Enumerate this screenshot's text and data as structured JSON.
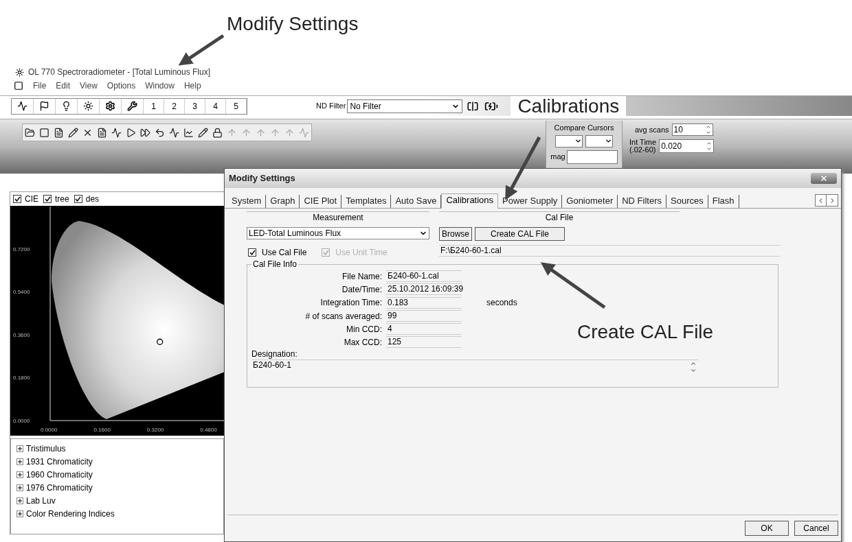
{
  "annotations": [
    {
      "text": "Modify Settings"
    },
    {
      "text": "Calibrations"
    },
    {
      "text": "Create CAL File"
    }
  ],
  "window": {
    "title": "OL 770 Spectroradiometer - [Total Luminous Flux]"
  },
  "menu": [
    "File",
    "Edit",
    "View",
    "Options",
    "Window",
    "Help"
  ],
  "toolbar": {
    "number_buttons": [
      "1",
      "2",
      "3",
      "4",
      "5"
    ],
    "nd_filter": {
      "label": "ND Filter",
      "value": "No Filter"
    }
  },
  "compare_cursors": {
    "label": "Compare Cursors",
    "mag_label": "mag"
  },
  "avg_scans": {
    "label": "avg scans",
    "value": "10"
  },
  "int_time": {
    "label": "Int Time",
    "range": "(.02-60)",
    "value": "0.020"
  },
  "left_panel": {
    "checkboxes": [
      {
        "label": "CIE",
        "checked": true
      },
      {
        "label": "tree",
        "checked": true
      },
      {
        "label": "des",
        "checked": true
      }
    ],
    "chart_data": {
      "type": "scatter",
      "x": [
        0.33
      ],
      "series": [
        {
          "color": "#000000",
          "values": [
            0.33
          ]
        }
      ],
      "xlim": [
        0,
        0.525
      ],
      "ylim": [
        0,
        0.9
      ],
      "xticks": [
        {
          "value": 0,
          "label": "0.0000"
        },
        {
          "value": 0.16,
          "label": "0.1600"
        },
        {
          "value": 0.32,
          "label": "0.3200"
        },
        {
          "value": 0.48,
          "label": "0.4800"
        }
      ],
      "yticks": [
        {
          "value": 0,
          "label": "0.0000"
        },
        {
          "value": 0.18,
          "label": "0.1800"
        },
        {
          "value": 0.36,
          "label": "0.3600"
        },
        {
          "value": 0.54,
          "label": "0.5400"
        },
        {
          "value": 0.72,
          "label": "0.7200"
        }
      ]
    },
    "tree": [
      {
        "label": "Tristimulus",
        "expanded": false
      },
      {
        "label": "1931 Chromaticity",
        "expanded": false
      },
      {
        "label": "1960 Chromaticity",
        "expanded": false
      },
      {
        "label": "1976 Chromaticity",
        "expanded": false
      },
      {
        "label": "Lab Luv",
        "expanded": false
      },
      {
        "label": "Color Rendering Indices",
        "expanded": false
      }
    ]
  },
  "dialog": {
    "title": "Modify Settings",
    "tabs": [
      {
        "label": "System",
        "selected": false
      },
      {
        "label": "Graph",
        "selected": false
      },
      {
        "label": "CIE Plot",
        "selected": false
      },
      {
        "label": "Templates",
        "selected": false
      },
      {
        "label": "Auto Save",
        "selected": false
      },
      {
        "label": "Calibrations",
        "selected": true
      },
      {
        "label": "Power Supply",
        "selected": false
      },
      {
        "label": "Goniometer",
        "selected": false
      },
      {
        "label": "ND Filters",
        "selected": false
      },
      {
        "label": "Sources",
        "selected": false
      },
      {
        "label": "Flash",
        "selected": false
      }
    ],
    "measurement": {
      "header": "Measurement",
      "value": "LED-Total Luminous Flux"
    },
    "options": [
      {
        "label": "Use Cal File",
        "checked": true,
        "disabled": false
      },
      {
        "label": "Use Unit Time",
        "checked": true,
        "disabled": true
      }
    ],
    "cal_file": {
      "header": "Cal File",
      "buttons": [
        "Browse",
        "Create CAL File"
      ],
      "path": "F:\\Б240-60-1.cal"
    },
    "cal_file_info": {
      "title": "Cal File Info",
      "rows": [
        {
          "label": "File Name:",
          "value": "Б240-60-1.cal"
        },
        {
          "label": "Date/Time:",
          "value": "25.10.2012 16:09:39"
        },
        {
          "label": "Integration Time:",
          "value": "0.183",
          "unit": "seconds"
        },
        {
          "label": "# of scans averaged:",
          "value": "99"
        },
        {
          "label": "Min CCD:",
          "value": "4"
        },
        {
          "label": "Max CCD:",
          "value": "125"
        }
      ],
      "designation_label": "Designation:",
      "designation": "Б240-60-1"
    },
    "buttons": [
      "OK",
      "Cancel"
    ]
  }
}
